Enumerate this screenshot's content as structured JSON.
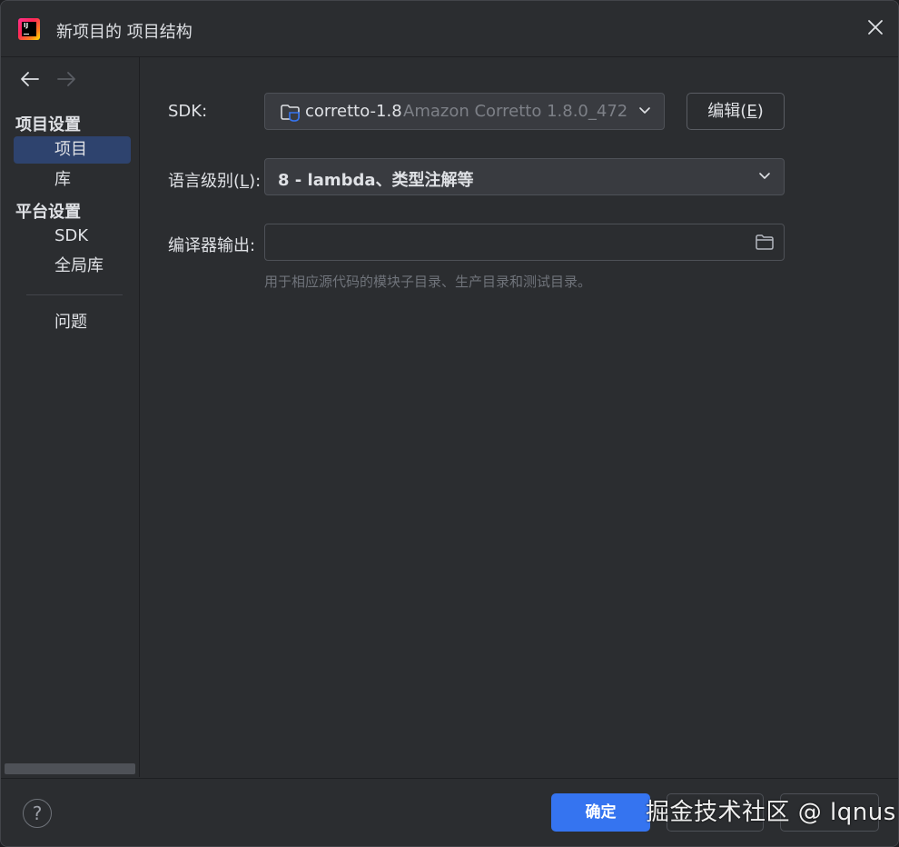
{
  "window": {
    "title": "新项目的 项目结构"
  },
  "sidebar": {
    "project_settings_title": "项目设置",
    "items_project": [
      "项目",
      "库"
    ],
    "platform_settings_title": "平台设置",
    "items_platform": [
      "SDK",
      "全局库"
    ],
    "problems": "问题",
    "selected": "项目"
  },
  "sdk": {
    "label": "SDK:",
    "name": "corretto-1.8",
    "detail": "Amazon Corretto 1.8.0_472",
    "edit_button": "编辑(E)",
    "edit_mnemonic_pre": "编辑(",
    "edit_mnemonic_key": "E",
    "edit_mnemonic_post": ")"
  },
  "language_level": {
    "label_pre": "语言级别(",
    "label_key": "L",
    "label_post": "):",
    "value": "8 - lambda、类型注解等"
  },
  "compiler_output": {
    "label": "编译器输出:",
    "value": "",
    "hint": "用于相应源代码的模块子目录、生产目录和测试目录。"
  },
  "footer": {
    "help": "?",
    "ok_button": "确定",
    "watermark": "掘金技术社区 @ lqnus"
  },
  "colors": {
    "background": "#2b2d30",
    "field": "#393b40",
    "selection": "#2e436e",
    "accent": "#3574f0",
    "text": "#dfe1e5",
    "hint": "#6f737a"
  },
  "icons": [
    "app-logo-icon",
    "close-icon",
    "back-arrow-icon",
    "forward-arrow-icon",
    "sdk-folder-icon",
    "chevron-down-icon",
    "folder-icon",
    "help-icon"
  ]
}
